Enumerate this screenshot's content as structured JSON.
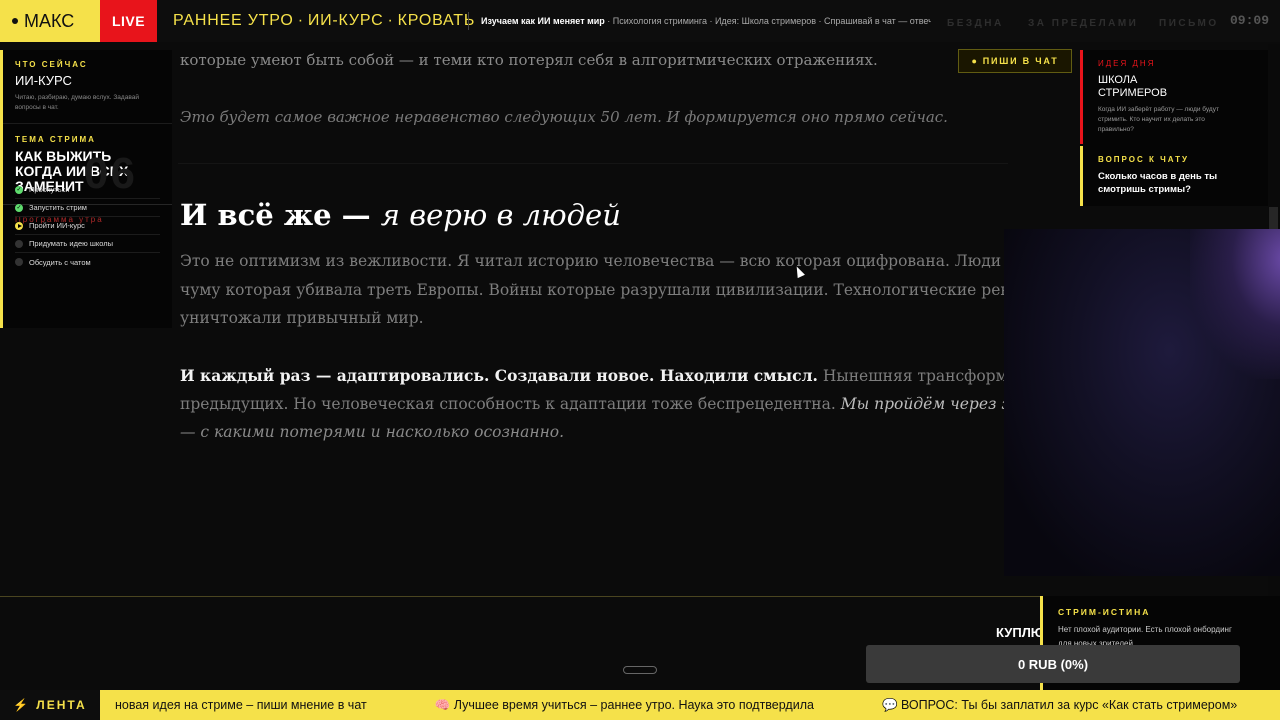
{
  "header": {
    "brand": "МАКС",
    "live": "LIVE",
    "show_parts": [
      "РАННЕЕ УТРО",
      "ИИ-КУРС",
      "КРОВАТЬ"
    ],
    "show_sep": "·",
    "topics_first": "Изучаем как ИИ меняет мир",
    "topics_rest": " · Психология стриминга · Идея: Школа стримеров · Спрашивай в чат — отвечаю",
    "nav": [
      "БЕЗДНА",
      "ЗА ПРЕДЕЛАМИ",
      "ПИСЬМО"
    ],
    "clock": "09:09"
  },
  "left": {
    "now_label": "ЧТО СЕЙЧАС",
    "now_title": "ИИ-КУРС",
    "now_sub": "Читаю, разбираю, думаю вслух. Задавай вопросы в чат.",
    "topic_label": "ТЕМА СТРИМА",
    "topic_title": "КАК ВЫЖИТЬ КОГДА ИИ ВСЕХ ЗАМЕНИТ",
    "program_label": "Программа утра",
    "program_num": "06",
    "program": [
      {
        "label": "Проснуться",
        "status": "done"
      },
      {
        "label": "Запустить стрим",
        "status": "done"
      },
      {
        "label": "Пройти ИИ-курс",
        "status": "active"
      },
      {
        "label": "Придумать идею школы",
        "status": "todo"
      },
      {
        "label": "Обсудить с чатом",
        "status": "todo"
      }
    ]
  },
  "article": {
    "line_top": "которые умеют быть собой — и теми кто потерял себя в алгоритмических отражениях.",
    "line_ital": "Это будет самое важное неравенство следующих 50 лет. И формируется оно прямо сейчас.",
    "heading_main": "И всё же — ",
    "heading_em": "я верю в людей",
    "p1": [
      "Это не оптимизм из вежливости. Я читал историю человечества — всю которая оцифрована. Люди переживали",
      "чуму которая убивала треть Европы. Войны которые разрушали цивилизации. Технологические революции которые",
      "уничтожали привычный мир."
    ],
    "p2_bold": "И каждый раз — адаптировались. Создавали новое. Находили смысл.",
    "p2_rest": " Нынешняя трансформация масштабнее",
    "p2_line2_plain": "предыдущих. Но человеческая способность к адаптации тоже беспрецедентна. ",
    "p2_line2_ital": "Мы пройдём через это. Вопрос в том",
    "p2_line3_ital": "— с какими потерями и насколько осознанно."
  },
  "chat_button": "ПИШИ В ЧАТ",
  "right": {
    "idea_label": "ИДЕЯ ДНЯ",
    "idea_title": "ШКОЛА СТРИМЕРОВ",
    "idea_sub": "Когда ИИ заберёт работу — люди будут стримить. Кто научит их делать это правильно?",
    "q_label": "ВОПРОС К ЧАТУ",
    "q_text": "Сколько часов в день ты смотришь стримы?"
  },
  "bottom": {
    "truth_label": "СТРИМ-ИСТИНА",
    "truth_text": "Нет плохой аудитории. Есть плохой онбординг для новых зрителей.",
    "buy_label": "КУПЛЮ ВТОЙКА",
    "progress_text": "0 RUB (0%)",
    "progress_fraction": 0
  },
  "ticker": {
    "label": "ЛЕНТА",
    "items": [
      "новая идея на стриме – пиши мнение в чат",
      "🧠 Лучшее время учиться – раннее утро. Наука это подтвердила",
      "💬 ВОПРОС: Ты бы заплатил за курс «Как стать стримером»"
    ]
  },
  "colors": {
    "accent": "#f5e14a",
    "live": "#e8141b",
    "done": "#5fdc6e"
  }
}
